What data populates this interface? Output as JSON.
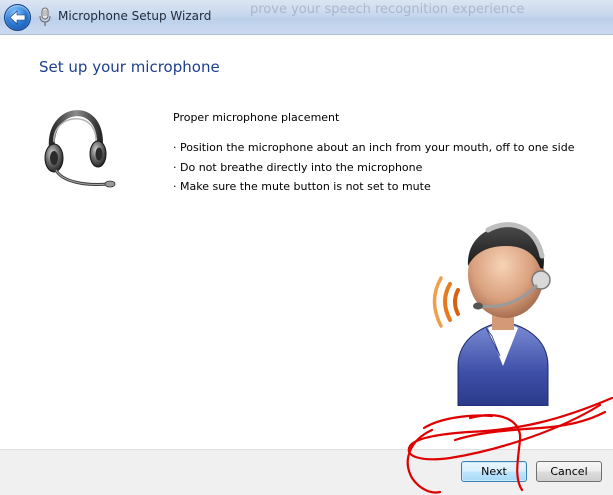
{
  "window": {
    "title": "Microphone Setup Wizard",
    "ghost_title": "prove your speech recognition experience"
  },
  "page": {
    "heading": "Set up your microphone",
    "subheading": "Proper microphone placement",
    "bullets": [
      "· Position the microphone about an inch from your mouth, off to one side",
      "· Do not breathe directly into the microphone",
      "· Make sure the mute button is not set to mute"
    ]
  },
  "footer": {
    "next_label": "Next",
    "cancel_label": "Cancel"
  },
  "colors": {
    "heading": "#1e3f8a",
    "annotation": "#e00000"
  },
  "icons": {
    "back": "back-arrow-icon",
    "app": "microphone-icon",
    "headset": "headset-icon",
    "person": "person-with-headset-icon"
  }
}
